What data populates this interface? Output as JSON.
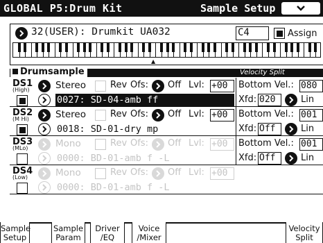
{
  "header": {
    "title": "GLOBAL P5:Drum Kit",
    "page": "Sample Setup",
    "menu_icon": "chevron-down-icon"
  },
  "kit": {
    "name": "32(USER): Drumkit  UA032",
    "note": "C4",
    "assign_label": "Assign",
    "assign_checked": true
  },
  "section": {
    "drumsample_label": "Drumsample",
    "velocity_split_label": "Velocity Split"
  },
  "rows": [
    {
      "id": "DS1",
      "sub": "(High)",
      "mode": "Stereo",
      "rev": "Rev",
      "ofs_label": "Ofs:",
      "ofs": "Off",
      "lvl_label": "Lvl:",
      "lvl": "+00",
      "sample": "0027: SD-04-amb ff",
      "bottom_vel_label": "Bottom Vel.:",
      "bottom_vel": "080",
      "xfd_label": "Xfd:",
      "xfd": "020",
      "curve": "Lin",
      "enabled": true
    },
    {
      "id": "DS2",
      "sub": "(M Hi)",
      "mode": "Stereo",
      "rev": "Rev",
      "ofs_label": "Ofs:",
      "ofs": "Off",
      "lvl_label": "Lvl:",
      "lvl": "+00",
      "sample": "0018: SD-01-dry mp",
      "bottom_vel_label": "Bottom Vel.:",
      "bottom_vel": "001",
      "xfd_label": "Xfd:",
      "xfd": "Off",
      "curve": "Lin",
      "enabled": true
    },
    {
      "id": "DS3",
      "sub": "(MLo)",
      "mode": "Mono",
      "rev": "Rev",
      "ofs_label": "Ofs:",
      "ofs": "Off",
      "lvl_label": "Lvl:",
      "lvl": "+00",
      "sample": "0000: BD-01-amb f -L",
      "bottom_vel_label": "Bottom Vel.:",
      "bottom_vel": "001",
      "xfd_label": "Xfd:",
      "xfd": "Off",
      "curve": "Lin",
      "enabled": false
    },
    {
      "id": "DS4",
      "sub": "(Low)",
      "mode": "Mono",
      "rev": "Rev",
      "ofs_label": "Ofs:",
      "ofs": "Off",
      "lvl_label": "Lvl:",
      "lvl": "+00",
      "sample": "0000: BD-01-amb f -L",
      "enabled": false
    }
  ],
  "tabs": [
    {
      "line1": "Sample",
      "line2": "Setup"
    },
    {
      "line1": "Sample",
      "line2": "Param"
    },
    {
      "line1": "Driver",
      "line2": "/EQ"
    },
    {
      "line1": "Voice",
      "line2": "/Mixer"
    },
    {
      "line1": "Velocity",
      "line2": "Split"
    }
  ]
}
